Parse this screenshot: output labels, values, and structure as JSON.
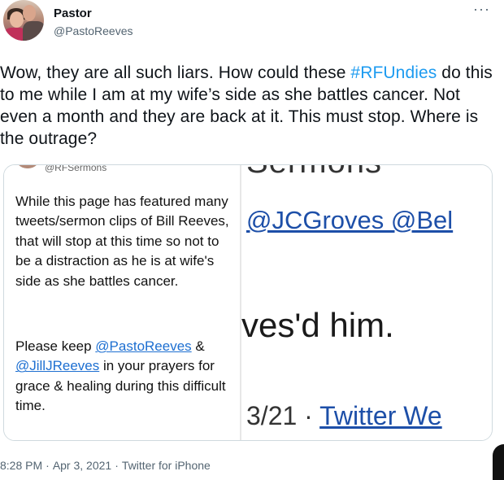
{
  "author": {
    "display_name": "Pastor",
    "handle": "@PastoReeves"
  },
  "more_icon_glyph": "···",
  "tweet": {
    "text_before": "Wow, they are all such liars. How could these ",
    "hashtag": "#RFUndies",
    "text_after": " do this to me while I am at my wife’s side as she battles cancer. Not even a month and they are back at it. This must stop. Where is the outrage?"
  },
  "media": {
    "cut_handle": "@RFSermons",
    "left_paragraph_1": "While this page has featured many tweets/sermon clips of Bill Reeves, that will stop at this time so not to be a distraction as he is at wife's side as she battles cancer.",
    "left_p2_before": "Please keep ",
    "left_p2_mention_1": "@PastoReeves",
    "left_p2_mid": " & ",
    "left_p2_mention_2": "@JillJReeves",
    "left_p2_after": " in your prayers for grace & healing during this difficult time.",
    "right_top_cut": "Sermons",
    "right_mentions": "@JCGroves @Bel",
    "right_big_text": "ves'd him.",
    "right_bottom_date": "3/21 · ",
    "right_bottom_link": "Twitter We"
  },
  "meta": {
    "time": "8:28 PM",
    "date": "Apr 3, 2021",
    "source": "Twitter for iPhone",
    "separator": "·"
  },
  "colors": {
    "link": "#1d9bf0",
    "text": "#0f1419",
    "muted": "#536471"
  }
}
